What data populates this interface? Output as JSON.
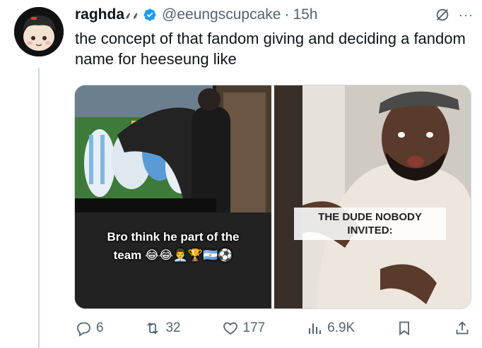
{
  "tweet": {
    "display_name": "raghda",
    "name_suffix": "⸙⸙",
    "handle": "@eeungscupcake",
    "separator": "·",
    "time": "15h",
    "more": "···",
    "text": "the concept of that fandom giving and deciding a fandom name for heeseung like"
  },
  "media": {
    "left_caption_line1": "Bro think he part of the",
    "left_caption_line2": "team 😂😂👨‍💼🏆🇦🇷⚽",
    "right_caption": "THE DUDE NOBODY INVITED:"
  },
  "actions": {
    "replies": "6",
    "reposts": "32",
    "likes": "177",
    "views": "6.9K"
  },
  "colors": {
    "verified": "#1d9bf0",
    "secondary_text": "#536471",
    "primary_text": "#0f1419"
  }
}
